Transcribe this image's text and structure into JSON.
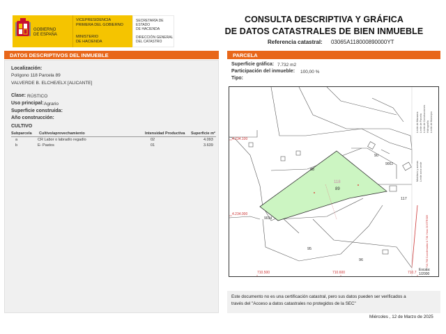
{
  "header": {
    "gov_line1": "GOBIERNO",
    "gov_line2": "DE ESPAÑA",
    "vice_line1": "VICEPRESIDENCIA",
    "vice_line2": "PRIMERA DEL GOBIERNO",
    "min_line1": "MINISTERIO",
    "min_line2": "DE HACIENDA",
    "secr_line1": "SECRETARÍA DE ESTADO",
    "secr_line2": "DE HACIENDA",
    "dir_line1": "DIRECCIÓN GENERAL",
    "dir_line2": "DEL CATASTRO",
    "title_line1": "CONSULTA DESCRIPTIVA Y GRÁFICA",
    "title_line2": "DE DATOS CATASTRALES DE BIEN INMUEBLE",
    "ref_label": "Referencia catastral:",
    "ref_value": "03065A118000890000YT"
  },
  "left": {
    "section_title": "DATOS DESCRIPTIVOS DEL INMUEBLE",
    "loc_label": "Localización:",
    "loc_line1": "Polígono 118 Parcela 89",
    "loc_line2": "VALVERDE B. ELCHE/ELX [ALICANTE]",
    "clase_label": "Clase:",
    "clase_value": "RÚSTICO",
    "uso_label": "Uso principal:",
    "uso_value": "Agrario",
    "sup_label": "Superficie construida:",
    "anio_label": "Año construcción:",
    "cultivo_title": "CULTIVO",
    "table_headers": [
      "Subparcela",
      "Cultivo/aprovechamiento",
      "Intensidad Productiva",
      "Superficie m²"
    ],
    "rows": [
      {
        "sub": "a",
        "cultivo": "CR Labor o labradío regadío",
        "intensidad": "02",
        "superficie": "4.093"
      },
      {
        "sub": "b",
        "cultivo": "E- Pastos",
        "intensidad": "01",
        "superficie": "3.639"
      }
    ]
  },
  "right": {
    "section_title": "PARCELA",
    "sup_grafica_label": "Superficie gráfica:",
    "sup_grafica_value": "7.732 m2",
    "part_label": "Participación del inmueble:",
    "part_value": "100,00 %",
    "tipo_label": "Tipo:",
    "map_labels": {
      "coord_top": "4.234.100",
      "coord_mid": "4.234.000",
      "coord_x1": "710.500",
      "coord_x2": "710.600",
      "coord_x3": "710.7",
      "parcel_118": "118",
      "parcel_89": "89",
      "n88": "88",
      "n90": "90",
      "n9002": "9002",
      "n117": "117",
      "n9034": "9034",
      "n95": "95",
      "n96": "96",
      "scale_label": "Escala:",
      "scale_value": "1/2000"
    },
    "legend": [
      "Limite de Manzana",
      "Limite de Parcela",
      "Limite de Construcciones",
      "Mobiliario y aceras",
      "Limite zona verde",
      "Hidrografía",
      "Limite de Municipio"
    ],
    "side_text": "710,760 Coordenadas U.T.M. Huso 30 ETRS89"
  },
  "note": {
    "line1": "Este documento no es una certificación catastral, pero sus datos pueden ser verificados a",
    "line2": "través del \"Acceso a datos catastrales no protegidos de la SEC\""
  },
  "date": "Miércoles , 12 de Marzo de 2025",
  "colors": {
    "accent": "#e8671a",
    "parcel_fill": "#ccf5c2",
    "gov_yellow": "#f5c400"
  }
}
